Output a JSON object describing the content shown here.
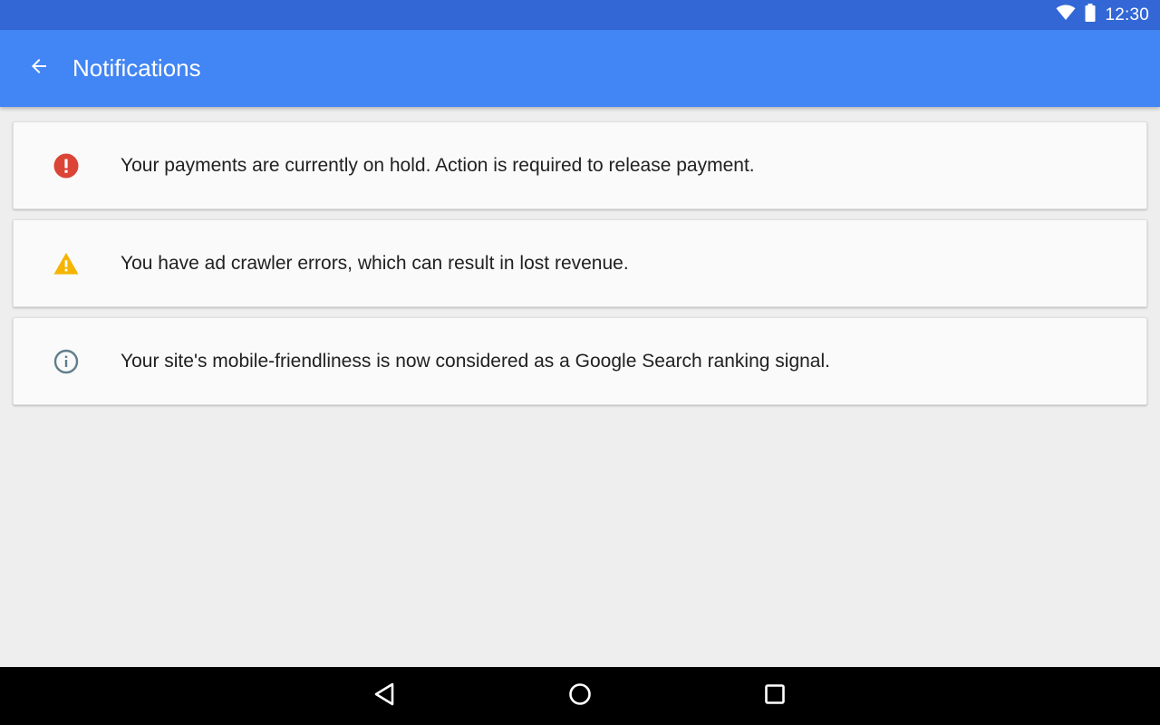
{
  "status_bar": {
    "time": "12:30",
    "icons": [
      "wifi-icon",
      "battery-icon"
    ]
  },
  "app_bar": {
    "title": "Notifications",
    "back_icon": "arrow-back-icon"
  },
  "notifications": [
    {
      "icon": "error-icon",
      "icon_color": "#db4437",
      "text": "Your payments are currently on hold. Action is required to release payment."
    },
    {
      "icon": "warning-icon",
      "icon_color": "#f4b400",
      "text": "You have ad crawler errors, which can result in lost revenue."
    },
    {
      "icon": "info-icon",
      "icon_color": "#607d8b",
      "text": "Your site's mobile-friendliness is now considered as a Google Search ranking signal."
    }
  ],
  "nav_bar": {
    "buttons": [
      "back-triangle-icon",
      "home-circle-icon",
      "recents-square-icon"
    ]
  },
  "colors": {
    "status_bar": "#3367d6",
    "app_bar": "#4285f4",
    "background": "#eeeeee",
    "card": "#fafafa",
    "nav_bar": "#000000"
  }
}
